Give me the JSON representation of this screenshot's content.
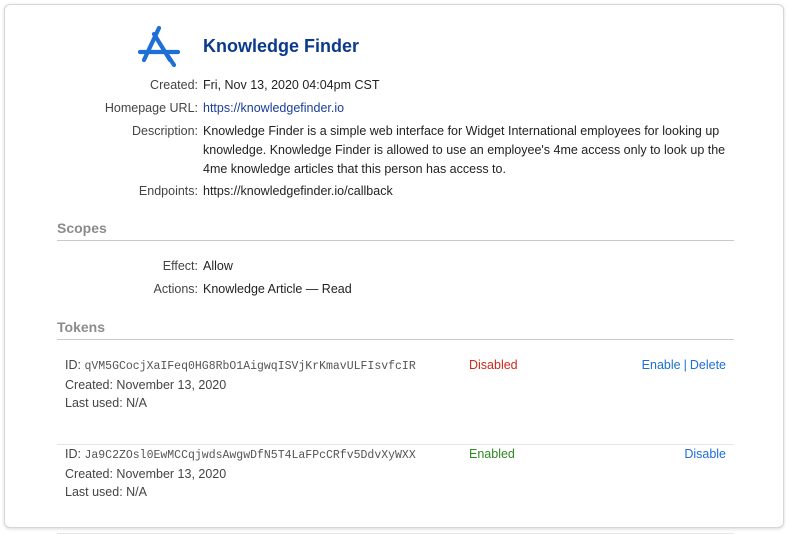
{
  "app": {
    "title": "Knowledge Finder",
    "logo_icon": "app-store-a-icon",
    "logo_color": "#1f6fd6"
  },
  "details": [
    {
      "label": "Created:",
      "value": "Fri, Nov 13, 2020 04:04pm CST"
    },
    {
      "label": "Homepage URL:",
      "value": "https://knowledgefinder.io"
    },
    {
      "label": "Description:",
      "value": "Knowledge Finder is a simple web interface for Widget International employees for looking up knowledge. Knowledge Finder is allowed to use an employee's 4me access only to look up the 4me knowledge articles that this person has access to."
    },
    {
      "label": "Endpoints:",
      "value": "https://knowledgefinder.io/callback"
    }
  ],
  "scopes": {
    "heading": "Scopes",
    "effect_label": "Effect:",
    "effect_value": "Allow",
    "actions_label": "Actions:",
    "actions_value": "Knowledge Article — Read"
  },
  "tokens": {
    "heading": "Tokens",
    "items": [
      {
        "id_label": "ID:",
        "id": "qVM5GCocjXaIFeq0HG8RbO1AigwqISVjKrKmavULFIsvfcIR",
        "created": "Created: November 13, 2020",
        "last_used": "Last used: N/A",
        "status": "Disabled",
        "actions": [
          "Enable",
          "Delete"
        ],
        "separator": "|"
      },
      {
        "id_label": "ID:",
        "id": "Ja9C2ZOsl0EwMCCqjwdsAwgwDfN5T4LaFPcCRfv5DdvXyWXX",
        "created": "Created: November 13, 2020",
        "last_used": "Last used: N/A",
        "status": "Enabled",
        "actions": [
          "Disable"
        ]
      }
    ]
  },
  "colors": {
    "title": "#0b3a8c",
    "link": "#1a3f9a",
    "action": "#1d6fd6",
    "disabled": "#cc2a1a",
    "enabled": "#2e8b1f"
  }
}
